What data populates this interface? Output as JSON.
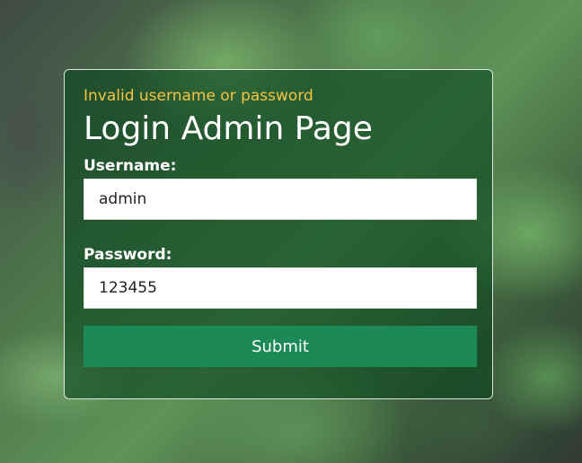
{
  "login": {
    "error_message": "Invalid username or password",
    "title": "Login Admin Page",
    "username_label": "Username:",
    "username_value": "admin",
    "password_label": "Password:",
    "password_value": "123455",
    "submit_label": "Submit"
  },
  "colors": {
    "error_text": "#f6c343",
    "submit_button": "#1c8a57",
    "card_overlay": "#0a461e"
  }
}
